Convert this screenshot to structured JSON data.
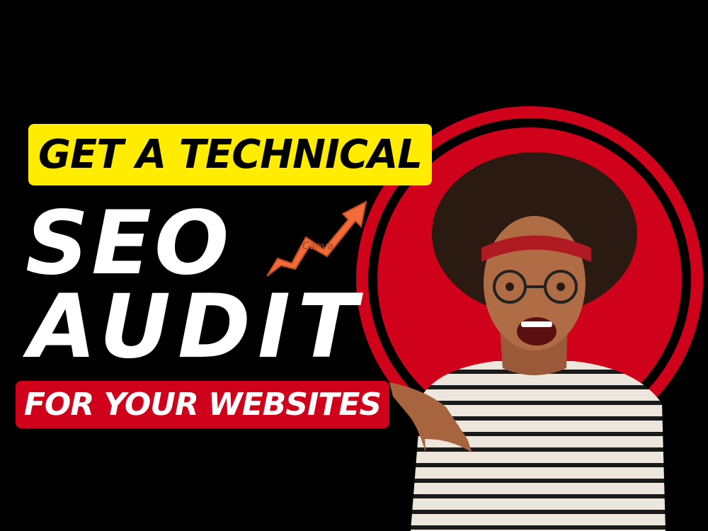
{
  "headline": {
    "top": "GET A TECHNICAL",
    "line1": "SEO",
    "line2": "AUDIT",
    "bottom": "FOR YOUR WEBSITES"
  },
  "watermark": "Canva",
  "colors": {
    "yellow": "#ffec00",
    "red": "#d0021b",
    "arrow": "#f26b3a",
    "background": "#000000"
  }
}
